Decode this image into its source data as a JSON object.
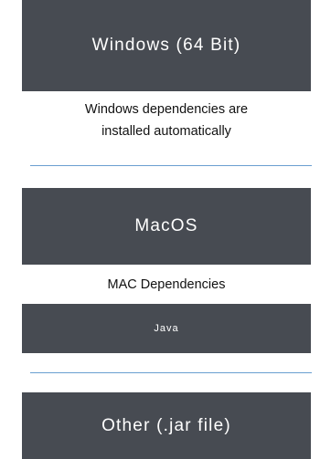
{
  "windows": {
    "button_label": "Windows (64 Bit)",
    "note_line1": "Windows dependencies are",
    "note_line2": "installed automatically"
  },
  "mac": {
    "button_label": "MacOS",
    "dependencies_label": "MAC Dependencies",
    "java_button_label": "Java"
  },
  "other": {
    "button_label": "Other (.jar file)"
  },
  "colors": {
    "button_bg": "#474b52",
    "button_text": "#ffffff",
    "divider": "#6a9fd0"
  }
}
